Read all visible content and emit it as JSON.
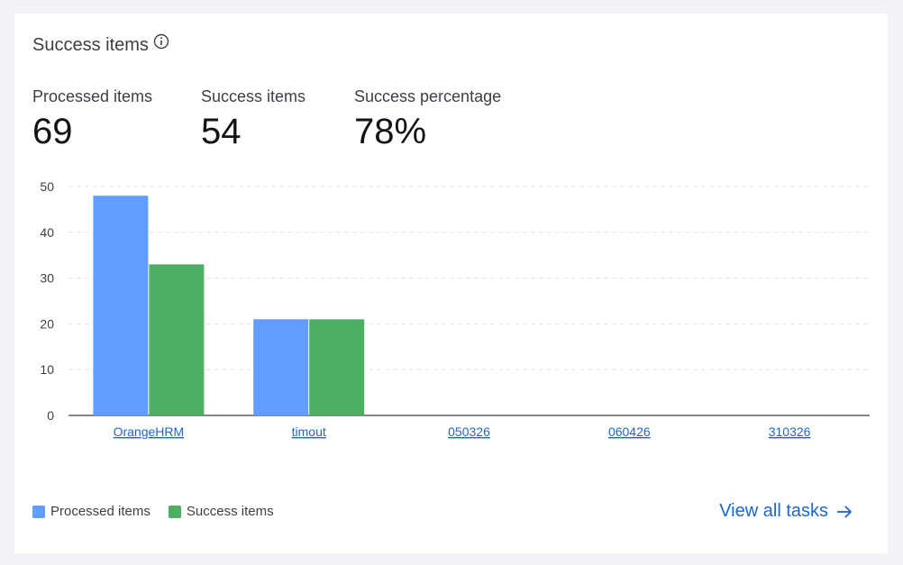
{
  "card": {
    "title": "Success items"
  },
  "stats": [
    {
      "label": "Processed items",
      "value": "69"
    },
    {
      "label": "Success items",
      "value": "54"
    },
    {
      "label": "Success percentage",
      "value": "78%"
    }
  ],
  "legend": [
    {
      "label": "Processed items",
      "color": "#619cff"
    },
    {
      "label": "Success items",
      "color": "#4caf64"
    }
  ],
  "footer": {
    "view_all_label": "View all tasks"
  },
  "colors": {
    "link": "#1967d2",
    "processed": "#619cff",
    "success": "#4caf64"
  },
  "icons": {
    "info": "info-icon",
    "arrow": "arrow-right-icon"
  },
  "chart_data": {
    "type": "bar",
    "categories": [
      "OrangeHRM",
      "timout",
      "050326",
      "060426",
      "310326"
    ],
    "series": [
      {
        "name": "Processed items",
        "values": [
          48,
          21,
          0,
          0,
          0
        ]
      },
      {
        "name": "Success items",
        "values": [
          33,
          21,
          0,
          0,
          0
        ]
      }
    ],
    "yticks": [
      0,
      10,
      20,
      30,
      40,
      50
    ],
    "ylim": [
      0,
      50
    ],
    "grid": true,
    "legend_position": "bottom-left"
  }
}
